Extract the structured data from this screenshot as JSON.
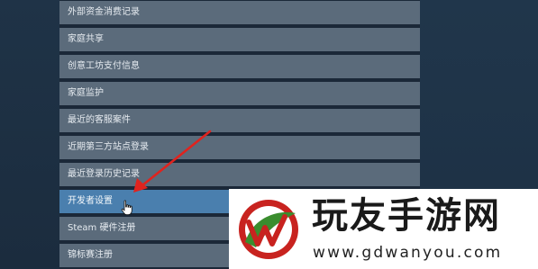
{
  "menu": {
    "items": [
      {
        "label": "外部资金消费记录"
      },
      {
        "label": "家庭共享"
      },
      {
        "label": "创意工坊支付信息"
      },
      {
        "label": "家庭监护"
      },
      {
        "label": "最近的客服案件"
      },
      {
        "label": "近期第三方站点登录"
      },
      {
        "label": "最近登录历史记录"
      },
      {
        "label": "开发者设置"
      },
      {
        "label": "Steam 硬件注册"
      },
      {
        "label": "锦标赛注册"
      }
    ],
    "highlighted_item": "开发者设置"
  },
  "watermark": {
    "title": "玩友手游网",
    "url": "www.gdwanyou.com"
  },
  "colors": {
    "background": "#1b2838",
    "menu_item": "#5b6b7b",
    "menu_item_active": "#4a7fae",
    "arrow": "#e0231e",
    "watermark_red": "#c8231f",
    "watermark_green": "#3a8d2e"
  }
}
